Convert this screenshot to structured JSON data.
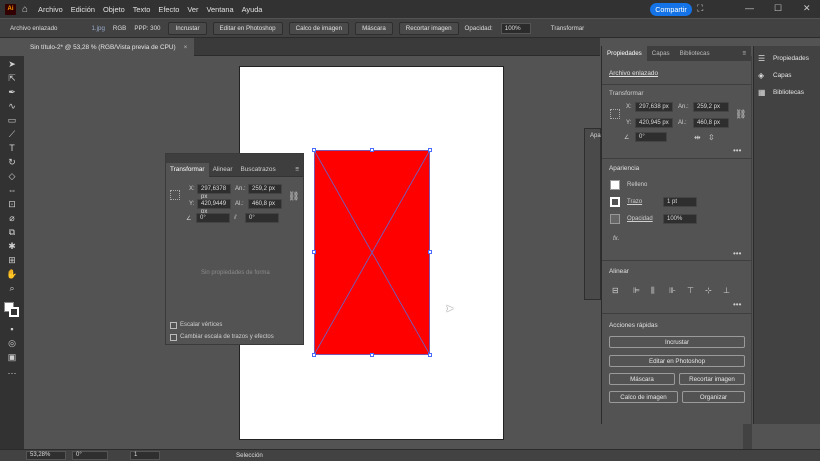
{
  "app": {
    "logo": "Ai"
  },
  "menu": [
    "Archivo",
    "Edición",
    "Objeto",
    "Texto",
    "Efecto",
    "Ver",
    "Ventana",
    "Ayuda"
  ],
  "share_label": "Compartir",
  "control": {
    "label": "Archivo enlazado",
    "file": "1.jpg",
    "mode": "RGB",
    "ppi": "PPP: 300",
    "incrustar": "Incrustar",
    "editar": "Editar en Photoshop",
    "calco": "Calco de imagen",
    "mascara": "Máscara",
    "recortar": "Recortar imagen",
    "opacity_label": "Opacidad:",
    "opacity_value": "100%",
    "transformar": "Transformar"
  },
  "document_tab": {
    "title": "Sin título-2* @ 53,28 % (RGB/Vista previa de CPU)",
    "close": "×"
  },
  "float_panel": {
    "tabs": [
      "Transformar",
      "Alinear",
      "Buscatrazos"
    ],
    "x_label": "X:",
    "x_value": "297,6378 px",
    "y_label": "Y:",
    "y_value": "420,9449 px",
    "w_label": "An.:",
    "w_value": "259,2 px",
    "h_label": "Al.:",
    "h_value": "460,8 px",
    "angle_value": "0°",
    "shear_value": "0°",
    "no_props": "Sin propiedades de forma",
    "scale_corners": "Escalar vértices",
    "scale_strokes": "Cambiar escala de trazos y efectos"
  },
  "props_panel": {
    "tabs": [
      "Propiedades",
      "Capas",
      "Bibliotecas"
    ],
    "object_type": "Archivo enlazado",
    "transform_title": "Transformar",
    "x_label": "X:",
    "x_value": "297,638 px",
    "y_label": "Y:",
    "y_value": "420,945 px",
    "w_label": "An.:",
    "w_value": "259,2 px",
    "h_label": "Al.:",
    "h_value": "460,8 px",
    "angle_value": "0°",
    "appearance_title": "Apariencia",
    "fill_label": "Relleno",
    "stroke_label": "Trazo",
    "stroke_value": "1 pt",
    "opacity_label": "Opacidad",
    "opacity_value": "100%",
    "fx": "fx.",
    "align_title": "Alinear",
    "quick_title": "Acciones rápidas",
    "btn_incrustar": "Incrustar",
    "btn_editar": "Editar en Photoshop",
    "btn_mascara": "Máscara",
    "btn_recortar": "Recortar imagen",
    "btn_calco": "Calco de imagen",
    "btn_organizar": "Organizar"
  },
  "behind_panel": {
    "tab": "Apa"
  },
  "side_strip": [
    "Propiedades",
    "Capas",
    "Bibliotecas"
  ],
  "status": {
    "zoom": "53,28%",
    "angle": "0°",
    "artboard": "1",
    "tool": "Selección"
  },
  "colors": {
    "red": "#ff0000",
    "accent": "#1473e6"
  }
}
